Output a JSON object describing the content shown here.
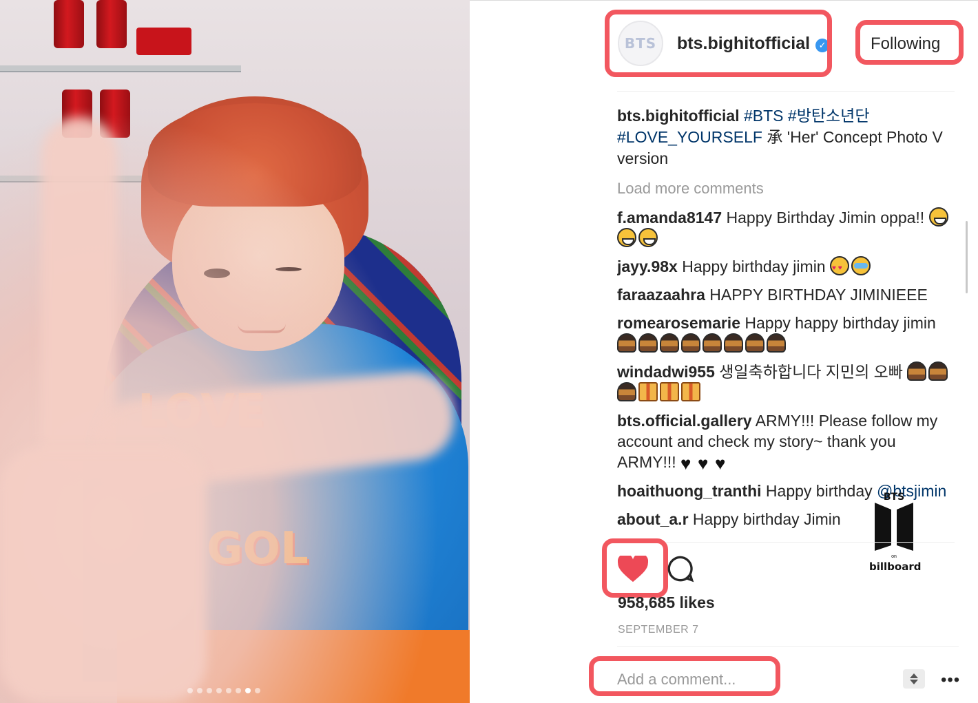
{
  "post": {
    "username": "bts.bighitofficial",
    "avatar_text": "BTS",
    "following_label": "Following",
    "caption_tags_line1": "#BTS #방탄소년단",
    "caption_tag2": "#LOVE_YOURSELF",
    "caption_rest": "承 'Her' Concept Photo V version",
    "load_more": "Load more comments",
    "likes": "958,685 likes",
    "date": "SEPTEMBER 7",
    "comment_placeholder": "Add a comment...",
    "more_label": "•••",
    "photo_dots": 8,
    "photo_active_dot": 6
  },
  "comments": [
    {
      "user": "f.amanda8147",
      "text": "Happy Birthday Jimin oppa!!",
      "emoji": [
        "grin",
        "grin",
        "grin"
      ]
    },
    {
      "user": "jayy.98x",
      "text": "Happy birthday jimin",
      "emoji": [
        "heart-eyes",
        "cry"
      ]
    },
    {
      "user": "faraazaahra",
      "text": "HAPPY BIRTHDAY JIMINIEEE",
      "emoji": []
    },
    {
      "user": "romearosemarie",
      "text": "Happy happy birthday jimin",
      "emoji": [
        "cake",
        "cake",
        "cake",
        "cake",
        "cake",
        "cake",
        "cake",
        "cake"
      ]
    },
    {
      "user": "windadwi955",
      "text": "생일축하합니다 지민의 오빠",
      "emoji": [
        "cake",
        "cake",
        "cake",
        "gift",
        "gift",
        "gift"
      ]
    },
    {
      "user": "bts.official.gallery",
      "text": "ARMY!!! Please follow my account and check my story~ thank you ARMY!!!",
      "emoji": [
        "bheart",
        "bheart",
        "bheart"
      ]
    },
    {
      "user": "hoaithuong_tranthi",
      "text": "Happy birthday",
      "mention": "@btsjimin",
      "emoji": []
    },
    {
      "user": "about_a.r",
      "text": "Happy birthday Jimin",
      "emoji": []
    }
  ],
  "watermark": {
    "top": "BTS",
    "on": "on",
    "bottom": "billboard"
  },
  "colors": {
    "highlight": "#f2575f",
    "heart": "#ed4956",
    "verified": "#3897f0",
    "hashtag": "#003569"
  },
  "icons": [
    "verified-badge-icon",
    "heart-icon",
    "comment-icon",
    "scroll-arrows-icon",
    "more-options-icon"
  ]
}
